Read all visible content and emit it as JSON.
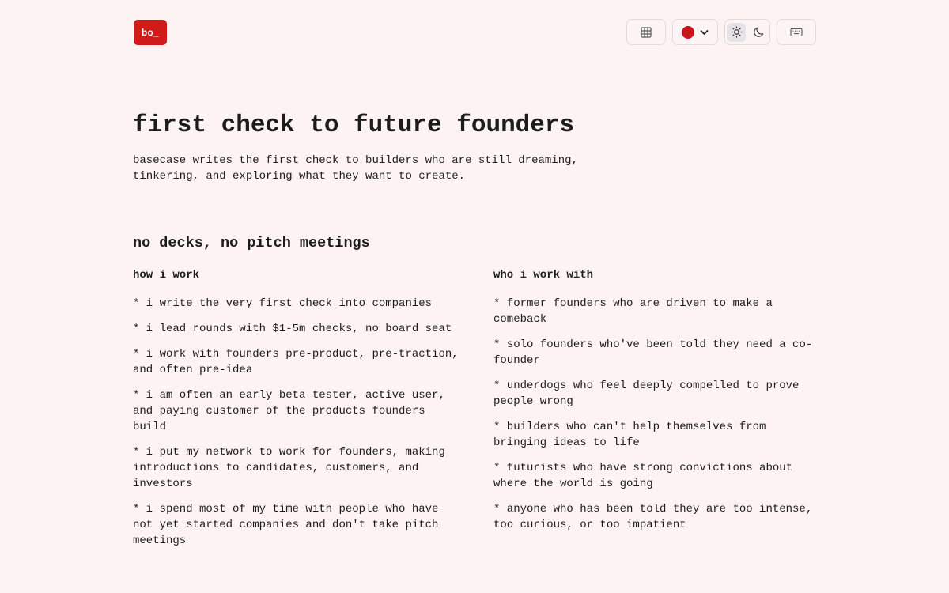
{
  "header": {
    "logo_text": "bo_",
    "brand_color": "#d11a1a",
    "toolbar": {
      "grid_icon": "grid-icon",
      "color_swatch": "#c8161b",
      "color_chevron_icon": "chevron-down-icon",
      "theme_light_icon": "sun-icon",
      "theme_dark_icon": "moon-icon",
      "theme_selected": "light",
      "keyboard_icon": "keyboard-icon"
    }
  },
  "hero": {
    "title": "first check to future founders",
    "description_line1": "basecase writes the first check to builders who are still dreaming,",
    "description_line2": "tinkering, and exploring what they want to create."
  },
  "section": {
    "title": "no decks, no pitch meetings",
    "how": {
      "heading": "how i work",
      "items": [
        "* i write the very first check into companies",
        "* i lead rounds with $1-5m checks, no board seat",
        "* i work with founders pre-product, pre-traction, and often pre-idea",
        "* i am often an early beta tester, active user, and paying customer of the products founders build",
        "* i put my network to work for founders, making introductions to candidates, customers, and investors",
        "* i spend most of my time with people who have not yet started companies and don't take pitch meetings"
      ]
    },
    "who": {
      "heading": "who i work with",
      "items": [
        "* former founders who are driven to make a comeback",
        "* solo founders who've been told they need a co-founder",
        "* underdogs who feel deeply compelled to prove people wrong",
        "* builders who can't help themselves from bringing ideas to life",
        "* futurists who have strong convictions about where the world is going",
        "* anyone who has been told they are too intense, too curious, or too impatient"
      ]
    }
  }
}
